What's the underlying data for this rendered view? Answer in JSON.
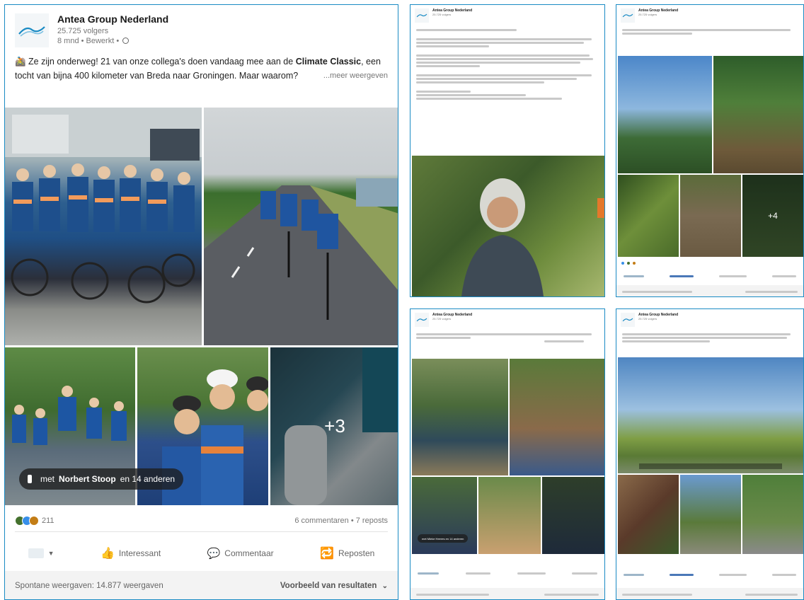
{
  "main_post": {
    "company": "Antea Group Nederland",
    "followers": "25.725 volgers",
    "meta": "8 mnd • Bewerkt •",
    "text_pre": "🚵 Ze zijn onderweg! 21 van onze collega's doen vandaag mee aan de ",
    "text_bold": "Climate Classic",
    "text_post": ", een tocht van bijna 400 kilometer van Breda naar Groningen. Maar waarom?",
    "see_more": "...meer weergeven",
    "tag_prefix": "met",
    "tag_name": "Norbert Stoop",
    "tag_suffix": "en 14 anderen",
    "more_photos": "+3",
    "reaction_count": "211",
    "comments_reposts": "6 commentaren • 7 reposts",
    "actions": [
      "Interessant",
      "Commentaar",
      "Reposten"
    ],
    "impressions": "Spontane weergaven: 14.877 weergaven",
    "preview_results": "Voorbeeld van resultaten"
  },
  "thumb_posts": [
    {
      "company": "Antea Group Nederland",
      "meta": "25.725 volgers",
      "kind": "text-portrait"
    },
    {
      "company": "Antea Group Nederland",
      "meta": "25.725 volgers",
      "kind": "nature",
      "more": "+4"
    },
    {
      "company": "Antea Group Nederland",
      "meta": "25.725 volgers",
      "kind": "group",
      "tag": "met Mieke Heeres en 14 anderen"
    },
    {
      "company": "Antea Group Nederland",
      "meta": "25.725 volgers",
      "kind": "park"
    }
  ],
  "colors": {
    "frame": "#1a8bc4",
    "like": "#378fe9",
    "celebrate": "#44712e",
    "support": "#c37d16"
  }
}
